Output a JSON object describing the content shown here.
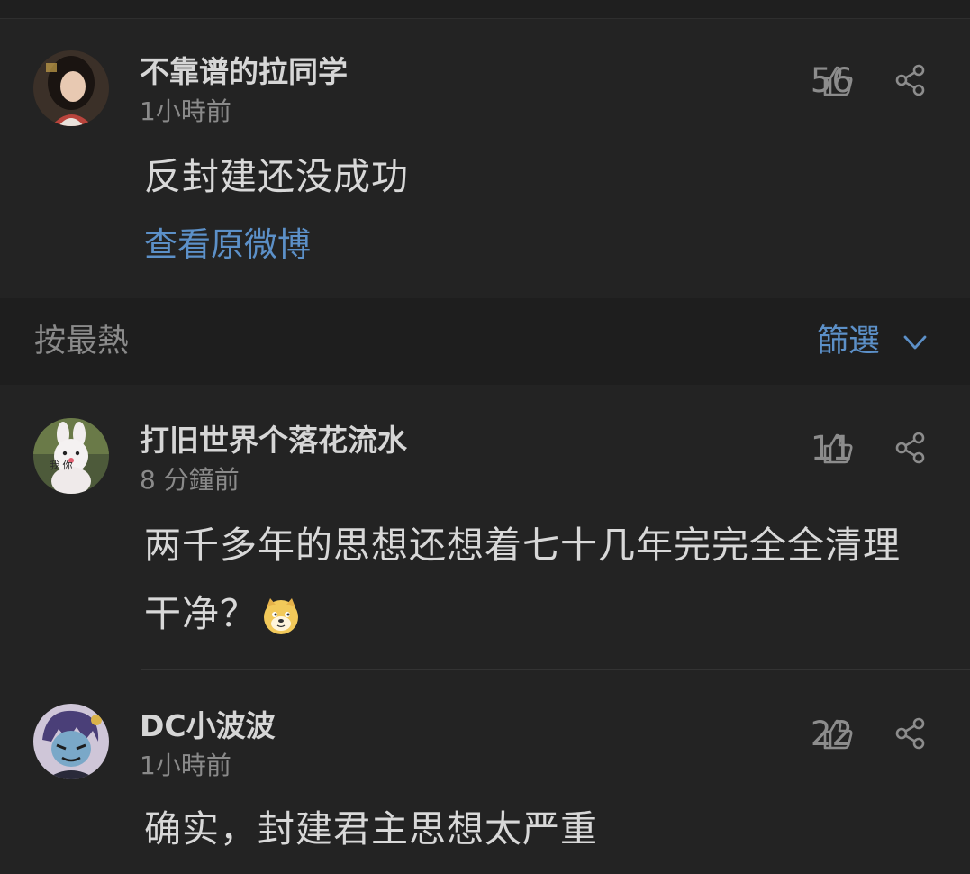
{
  "comments": [
    {
      "username": "不靠谱的拉同学",
      "time": "1小時前",
      "likes": "56",
      "text": "反封建还没成功",
      "link": "查看原微博",
      "avatar_icon": "avatar-woman-icon"
    },
    {
      "username": "打旧世界个落花流水",
      "time": "8 分鐘前",
      "likes": "11",
      "text": "两千多年的思想还想着七十几年完完全全清理干净？",
      "emoji": "doge-emoji-icon",
      "avatar_icon": "avatar-bunny-icon",
      "avatar_caption": "我 你"
    },
    {
      "username": "DC小波波",
      "time": "1小時前",
      "likes": "22",
      "text": "确实，封建君主思想太严重",
      "avatar_icon": "avatar-cartoon-icon"
    }
  ],
  "sort_bar": {
    "sort_label": "按最熱",
    "filter_label": "篩選",
    "filter_icon": "chevron-down-icon"
  },
  "colors": {
    "background": "#232323",
    "link": "#5c90c8",
    "text": "#d8d8d8",
    "muted": "#8a8a8a"
  }
}
